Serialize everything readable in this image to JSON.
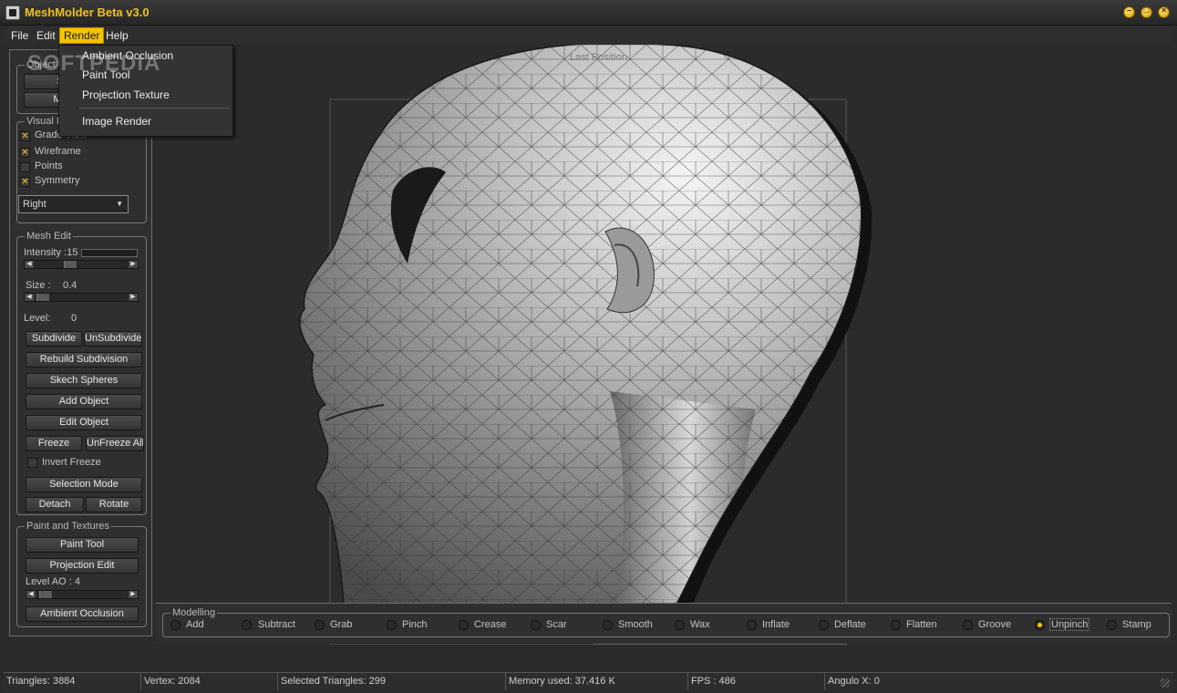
{
  "window": {
    "title": "MeshMolder Beta v3.0",
    "accent": "#f5c400",
    "controls": [
      "minimize-icon",
      "maximize-icon",
      "close-icon"
    ]
  },
  "menubar": {
    "file": "File",
    "edit": "Edit",
    "render": "Render",
    "help": "Help"
  },
  "render_menu": {
    "ambient_occlusion": "Ambient Occlusion",
    "paint_tool": "Paint Tool",
    "projection_texture": "Projection Texture",
    "image_render": "Image Render"
  },
  "watermark": "SOFTPEDIA",
  "viewport": {
    "caption": "Last Position"
  },
  "left_panel": {
    "object": {
      "title": "Object",
      "btn1": "S",
      "btn2": "Me"
    },
    "visual": {
      "title": "Visual I",
      "grade_view": "Grade View",
      "grade_view_checked": true,
      "wireframe": "Wireframe",
      "wireframe_checked": true,
      "points": "Points",
      "points_checked": false,
      "symmetry": "Symmetry",
      "symmetry_checked": true,
      "view_select": "Right"
    },
    "mesh_edit": {
      "title": "Mesh Edit",
      "intensity_label": "Intensity :",
      "intensity_value": "15",
      "size_label": "Size :",
      "size_value": "0.4",
      "level_label": "Level:",
      "level_value": "0",
      "subdivide": "Subdivide",
      "unsubdivide": "UnSubdivide",
      "rebuild_subdivision": "Rebuild Subdivision",
      "sketch_spheres": "Skech Spheres",
      "add_object": "Add Object",
      "edit_object": "Edit Object",
      "freeze": "Freeze",
      "unfreeze_all": "UnFreeze All",
      "invert_freeze": "Invert Freeze",
      "invert_freeze_checked": false,
      "selection_mode": "Selection Mode",
      "detach": "Detach",
      "rotate": "Rotate"
    },
    "paint": {
      "title": "Paint and Textures",
      "paint_tool": "Paint Tool",
      "projection_edit": "Projection Edit",
      "level_ao_label": "Level AO :",
      "level_ao_value": "4",
      "ambient_occlusion": "Ambient Occlusion"
    }
  },
  "modelling": {
    "title": "Modelling",
    "selected": "Unpinch",
    "tools": [
      "Add",
      "Subtract",
      "Grab",
      "Pinch",
      "Crease",
      "Scar",
      "Smooth",
      "Wax",
      "Inflate",
      "Deflate",
      "Flatten",
      "Groove",
      "Unpinch",
      "Stamp"
    ]
  },
  "status": {
    "triangles": "Triangles: 3884",
    "vertex": "Vertex: 2084",
    "selected_triangles": "Selected Triangles: 299",
    "memory": "Memory used: 37.416 K",
    "fps": "FPS : 486",
    "angle": "Angulo X: 0"
  }
}
